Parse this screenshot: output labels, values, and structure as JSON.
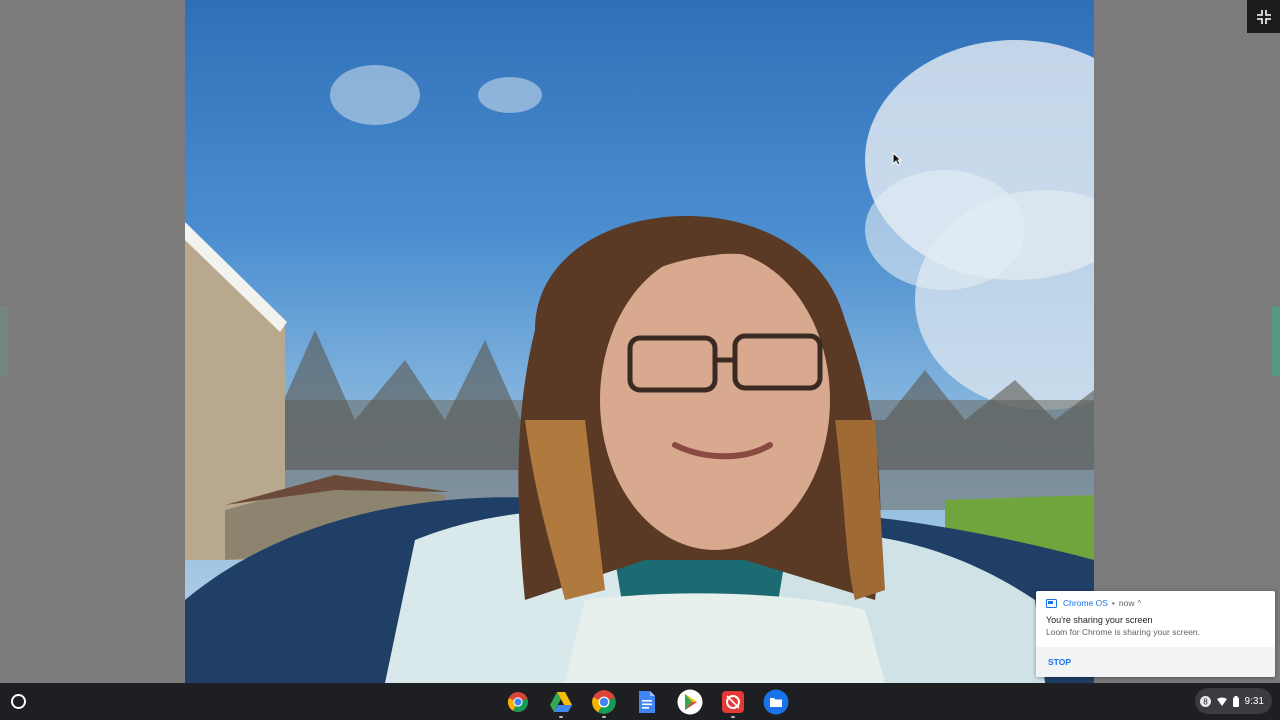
{
  "notification": {
    "app_name": "Chrome OS",
    "separator": "•",
    "time": "now",
    "chevron": "^",
    "title": "You're sharing your screen",
    "body": "Loom for Chrome is sharing your screen.",
    "stop_label": "STOP"
  },
  "shelf": {
    "launcher_icon": "launcher-circle-icon",
    "apps": [
      {
        "name": "chrome-icon"
      },
      {
        "name": "google-drive-icon"
      },
      {
        "name": "chrome-icon"
      },
      {
        "name": "google-docs-icon"
      },
      {
        "name": "google-play-icon"
      },
      {
        "name": "screencastify-icon"
      },
      {
        "name": "files-icon"
      }
    ],
    "tray": {
      "time": "9:31",
      "notification_count": "8"
    }
  },
  "colors": {
    "accent": "#1a73e8",
    "shelf": "#1d1f22"
  }
}
